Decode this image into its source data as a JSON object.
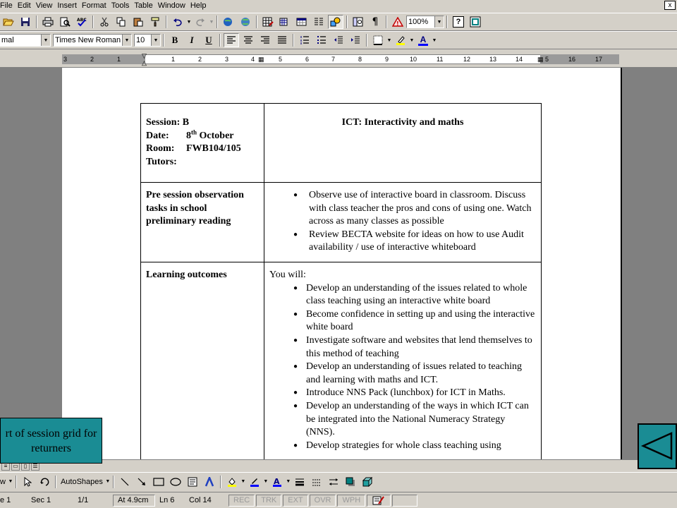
{
  "menubar": {
    "items": [
      "File",
      "Edit",
      "View",
      "Insert",
      "Format",
      "Tools",
      "Table",
      "Window",
      "Help"
    ],
    "close_glyph": "x"
  },
  "toolbar": {
    "zoom": "100%",
    "help_glyph": "?",
    "paragraph_glyph": "¶"
  },
  "format_bar": {
    "style": "mal",
    "font": "Times New Roman",
    "size": "10",
    "bold": "B",
    "italic": "I",
    "underline": "U",
    "font_color_glyph": "A"
  },
  "ruler": {
    "labels": [
      "3",
      "2",
      "1",
      "1",
      "1",
      "2",
      "3",
      "4",
      "5",
      "6",
      "7",
      "8",
      "9",
      "10",
      "11",
      "12",
      "13",
      "14",
      "5",
      "16",
      "17"
    ]
  },
  "document": {
    "header": {
      "session": "Session: B",
      "date_label": "Date:",
      "date_day": "8",
      "date_suffix": "th",
      "date_month": "October",
      "room_label": "Room:",
      "room_value": "FWB104/105",
      "tutors_label": "Tutors:",
      "title": "ICT: Interactivity and  maths"
    },
    "pre_session": {
      "label": "Pre session observation tasks in school preliminary reading",
      "items": [
        "Observe use of interactive board in classroom. Discuss with class teacher the pros and cons of using one. Watch across as many classes as possible",
        "Review BECTA website for ideas on how to use Audit availability / use of interactive whiteboard"
      ]
    },
    "learning_outcomes": {
      "label": "Learning outcomes",
      "intro": "You will:",
      "items": [
        "Develop an understanding of the issues related to whole class teaching using an interactive white board",
        "Become confidence in setting up and using the interactive white board",
        "Investigate software and websites that lend themselves to this method of teaching",
        "Develop an understanding of issues related to teaching and learning with maths and ICT.",
        "Introduce NNS Pack (lunchbox) for ICT in Maths.",
        "Develop an understanding of the ways in which ICT can be integrated into the National Numeracy Strategy (NNS).",
        "Develop strategies for whole class teaching using"
      ]
    }
  },
  "drawbar": {
    "draw_label": "w",
    "autoshapes_label": "AutoShapes"
  },
  "statusbar": {
    "page": "e 1",
    "sec": "Sec 1",
    "pages": "1/1",
    "at": "At  4.9cm",
    "ln": "Ln  6",
    "col": "Col  14",
    "rec": "REC",
    "trk": "TRK",
    "ext": "EXT",
    "ovr": "OVR",
    "wph": "WPH"
  },
  "overlay": {
    "callout_text": "rt of session grid for returners"
  },
  "colors": {
    "chrome": "#d4d0c8",
    "callout_teal": "#1a8c94",
    "workspace": "#808080"
  }
}
